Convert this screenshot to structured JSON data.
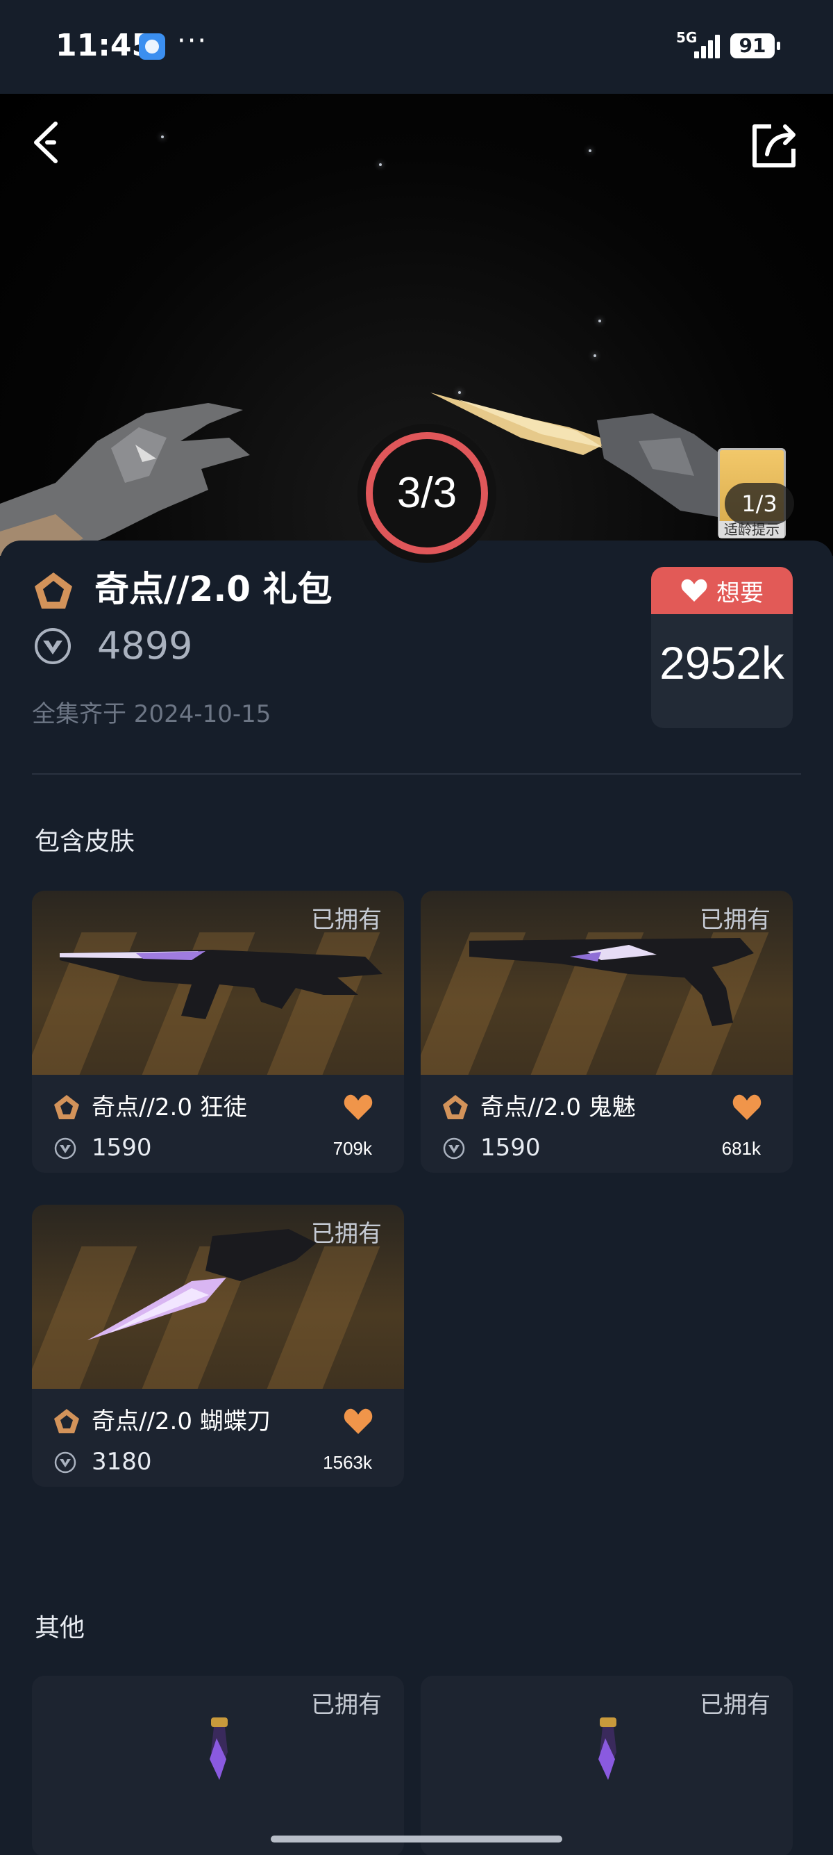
{
  "status_bar": {
    "time": "11:45",
    "dots": "···",
    "network": "5G",
    "battery": "91"
  },
  "hero": {
    "slide_ring": "3/3",
    "media_counter": "1/3",
    "age_badge_caption": "适龄提示"
  },
  "bundle": {
    "title": "奇点//2.0 礼包",
    "price": "4899",
    "date_label": "全集齐于 2024-10-15",
    "wish_label": "想要",
    "wish_count": "2952k"
  },
  "sections": {
    "skins_title": "包含皮肤",
    "others_title": "其他"
  },
  "skins": [
    {
      "owned": "已拥有",
      "name": "奇点//2.0 狂徒",
      "price": "1590",
      "likes": "709k"
    },
    {
      "owned": "已拥有",
      "name": "奇点//2.0 鬼魅",
      "price": "1590",
      "likes": "681k"
    },
    {
      "owned": "已拥有",
      "name": "奇点//2.0 蝴蝶刀",
      "price": "3180",
      "likes": "1563k"
    }
  ],
  "others": [
    {
      "owned": "已拥有"
    },
    {
      "owned": "已拥有"
    }
  ],
  "colors": {
    "accent_red": "#e25a57",
    "heart_orange": "#f0954a",
    "background": "#161e2a",
    "card": "#1d2430"
  }
}
